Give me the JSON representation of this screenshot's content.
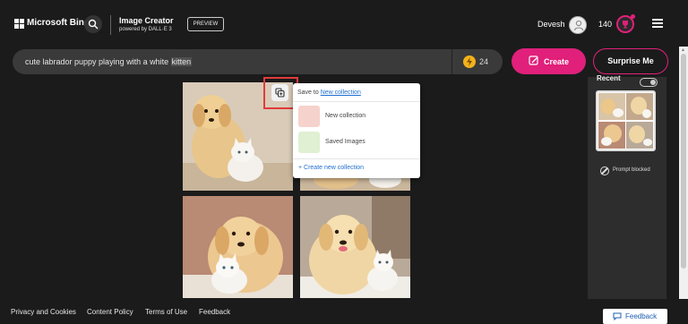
{
  "header": {
    "brand": "Microsoft Bing",
    "app_title": "Image Creator",
    "app_subtitle": "powered by DALL·E 3",
    "preview_badge": "PREVIEW",
    "user_name": "Devesh",
    "reward_points": "140"
  },
  "prompt": {
    "text_before": "cute labrador puppy playing with a white ",
    "text_highlight": "kitten",
    "boosts": "24",
    "create_label": "Create",
    "surprise_label": "Surprise Me"
  },
  "save_popup": {
    "save_to_label": "Save to",
    "save_to_link": "New collection",
    "collections": [
      {
        "name": "New collection",
        "color": "#f6d2cc"
      },
      {
        "name": "Saved Images",
        "color": "#dff0d3"
      }
    ],
    "create_new": "+ Create new collection"
  },
  "recent": {
    "title": "Recent",
    "blocked_label": "Prompt blocked"
  },
  "footer": {
    "links": [
      "Privacy and Cookies",
      "Content Policy",
      "Terms of Use",
      "Feedback"
    ],
    "feedback_button": "Feedback"
  },
  "colors": {
    "accent": "#e0207a",
    "background": "#1b1b1b",
    "highlight_box": "#e23b3b",
    "link": "#1f6fd1"
  },
  "icons": [
    "search-icon",
    "user-icon",
    "trophy-icon",
    "menu-icon",
    "boost-icon",
    "create-icon",
    "save-collection-icon",
    "blocked-icon",
    "feedback-icon"
  ]
}
